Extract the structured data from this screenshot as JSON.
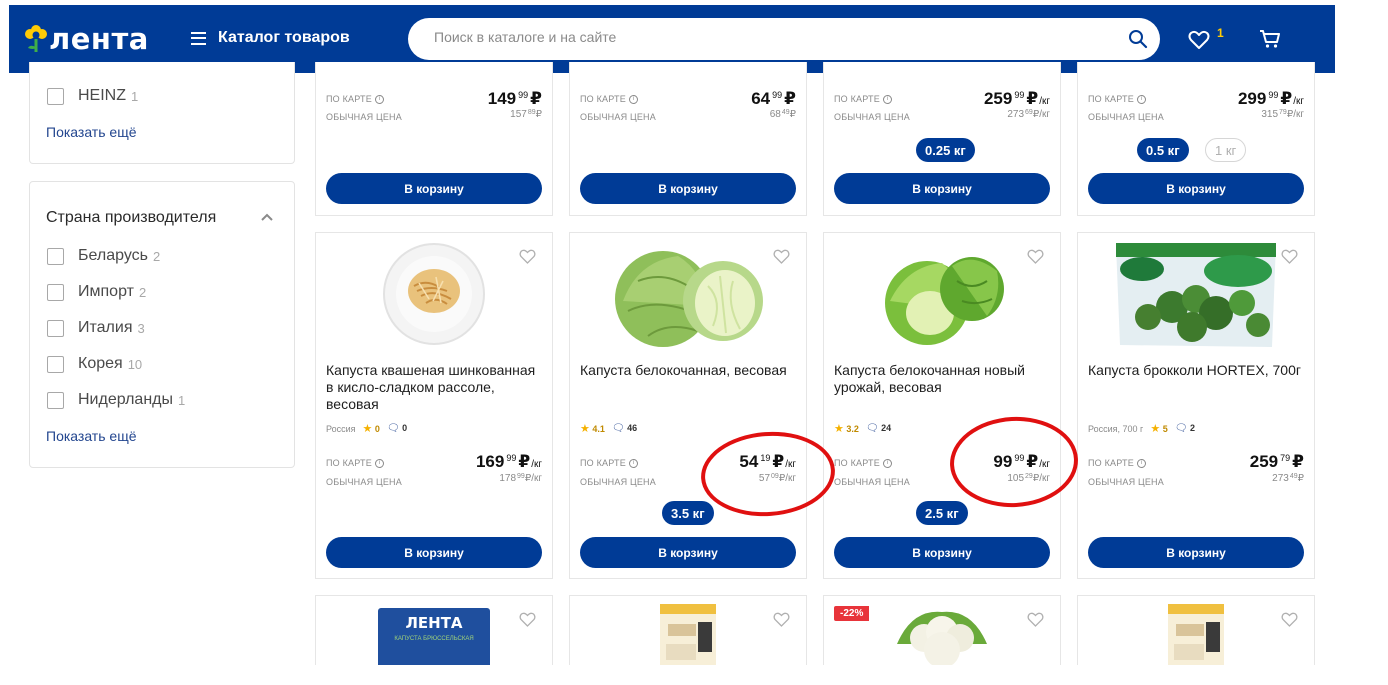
{
  "header": {
    "logo": "лента",
    "catalog_label": "Каталог товаров",
    "search_placeholder": "Поиск в каталоге и на сайте",
    "favorites_count": "1",
    "colors": {
      "brand": "#003b96",
      "accent": "#ffcb05"
    }
  },
  "sidebar": {
    "brand_filter": {
      "items": [
        {
          "label": "HEINZ",
          "count": "1"
        }
      ],
      "show_more": "Показать ещё"
    },
    "country_filter": {
      "title": "Страна производителя",
      "items": [
        {
          "label": "Беларусь",
          "count": "2"
        },
        {
          "label": "Импорт",
          "count": "2"
        },
        {
          "label": "Италия",
          "count": "3"
        },
        {
          "label": "Корея",
          "count": "10"
        },
        {
          "label": "Нидерланды",
          "count": "1"
        }
      ],
      "show_more": "Показать ещё"
    }
  },
  "labels": {
    "card_price": "ПО КАРТЕ",
    "regular_price": "ОБЫЧНАЯ ЦЕНА",
    "add_to_cart": "В корзину",
    "currency": "₽",
    "per_kg": "/кг"
  },
  "row0": [
    {
      "price_int": "149",
      "price_dec": "99",
      "unit": "",
      "old_int": "157",
      "old_dec": "89",
      "old_unit": "₽"
    },
    {
      "price_int": "64",
      "price_dec": "99",
      "unit": "",
      "old_int": "68",
      "old_dec": "49",
      "old_unit": "₽"
    },
    {
      "price_int": "259",
      "price_dec": "99",
      "unit": "/кг",
      "old_int": "273",
      "old_dec": "69",
      "old_unit": "₽/кг",
      "weights": [
        "0.25 кг"
      ]
    },
    {
      "price_int": "299",
      "price_dec": "99",
      "unit": "/кг",
      "old_int": "315",
      "old_dec": "79",
      "old_unit": "₽/кг",
      "weights": [
        "0.5 кг",
        "1 кг"
      ]
    }
  ],
  "row1": [
    {
      "title": "Капуста квашеная шинкованная в кисло-сладком рассоле, весовая",
      "origin": "Россия",
      "rating": "0",
      "reviews": "0",
      "price_int": "169",
      "price_dec": "99",
      "unit": "/кг",
      "old_int": "178",
      "old_dec": "99",
      "old_unit": "₽/кг"
    },
    {
      "title": "Капуста белокочанная, весовая",
      "origin": "",
      "rating": "4.1",
      "reviews": "46",
      "price_int": "54",
      "price_dec": "19",
      "unit": "/кг",
      "old_int": "57",
      "old_dec": "09",
      "old_unit": "₽/кг",
      "weight": "3.5 кг"
    },
    {
      "title": "Капуста белокочанная новый урожай, весовая",
      "origin": "",
      "rating": "3.2",
      "reviews": "24",
      "price_int": "99",
      "price_dec": "99",
      "unit": "/кг",
      "old_int": "105",
      "old_dec": "29",
      "old_unit": "₽/кг",
      "weight": "2.5 кг"
    },
    {
      "title": "Капуста брокколи HORTEX, 700г",
      "origin": "Россия, 700 г",
      "rating": "5",
      "reviews": "2",
      "price_int": "259",
      "price_dec": "79",
      "unit": "",
      "old_int": "273",
      "old_dec": "49",
      "old_unit": "₽"
    }
  ],
  "row2": {
    "discount_badge": "-22%",
    "package_brand": "ЛЕНТА",
    "package_label": "КАПУСТА БРЮССЕЛЬСКАЯ"
  }
}
